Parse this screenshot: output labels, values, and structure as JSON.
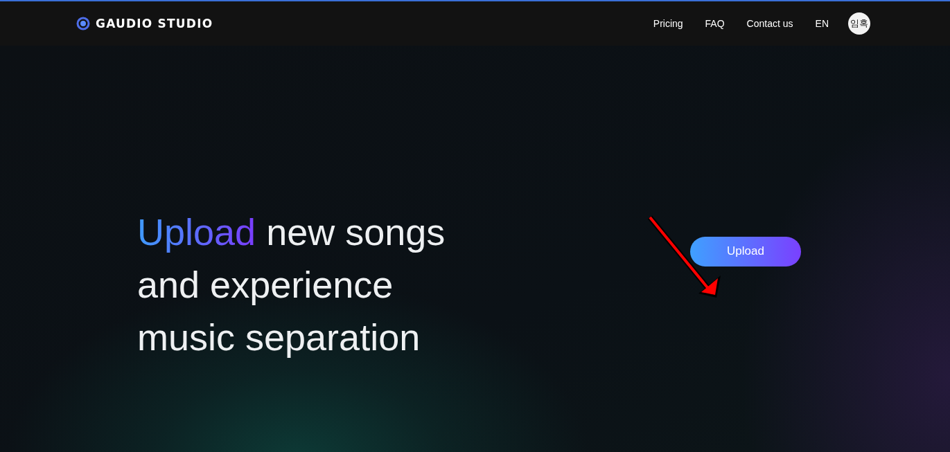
{
  "header": {
    "logo_text": "GAUDIO STUDIO",
    "nav": [
      {
        "label": "Pricing"
      },
      {
        "label": "FAQ"
      },
      {
        "label": "Contact us"
      },
      {
        "label": "EN"
      }
    ],
    "avatar": "임혹"
  },
  "hero": {
    "highlight": "Upload",
    "lines": [
      " new songs",
      "and experience",
      "music separation"
    ],
    "button": "Upload",
    "annotation": {
      "kind": "arrow"
    }
  }
}
